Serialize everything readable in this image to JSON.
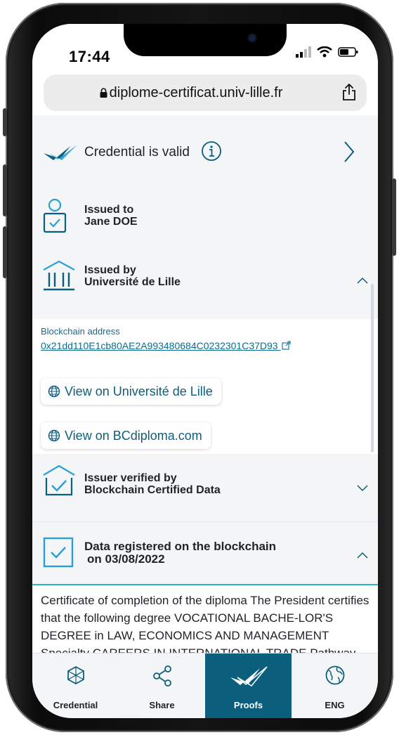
{
  "status": {
    "time": "17:44"
  },
  "browser": {
    "url": "diplome-certificat.univ-lille.fr"
  },
  "validity": {
    "label": "Credential is valid"
  },
  "issued_to": {
    "title": "Issued to",
    "name": "Jane DOE"
  },
  "issued_by": {
    "title": "Issued by",
    "name": "Université de Lille"
  },
  "blockchain": {
    "label": "Blockchain address",
    "address": "0x21dd110E1cb80AE2A993480684C0232301C37D93"
  },
  "links": {
    "view_univ": "View on Université de Lille",
    "view_bcd": "View on BCdiploma.com"
  },
  "issuer_verified": {
    "title": "Issuer verified by",
    "name": "Blockchain Certified Data"
  },
  "data_registered": {
    "title": "Data registered on the blockchain",
    "date": "on 03/08/2022"
  },
  "description": "Certificate of completion of the diploma The President certifies that the following degree VOCATIONAL BACHE-LOR'S DEGREE in LAW, ECONOMICS AND MANAGEMENT Specialty CAREERS IN INTERNATIONAL TRADE Pathway",
  "tabs": [
    {
      "label": "Credential",
      "icon": "credential-icon"
    },
    {
      "label": "Share",
      "icon": "share-icon"
    },
    {
      "label": "Proofs",
      "icon": "proofs-icon"
    },
    {
      "label": "ENG",
      "icon": "globe-icon"
    }
  ],
  "colors": {
    "accent": "#0b5f7c",
    "icon_blue": "#2a9fd6",
    "check_dark": "#0b5f7c"
  }
}
